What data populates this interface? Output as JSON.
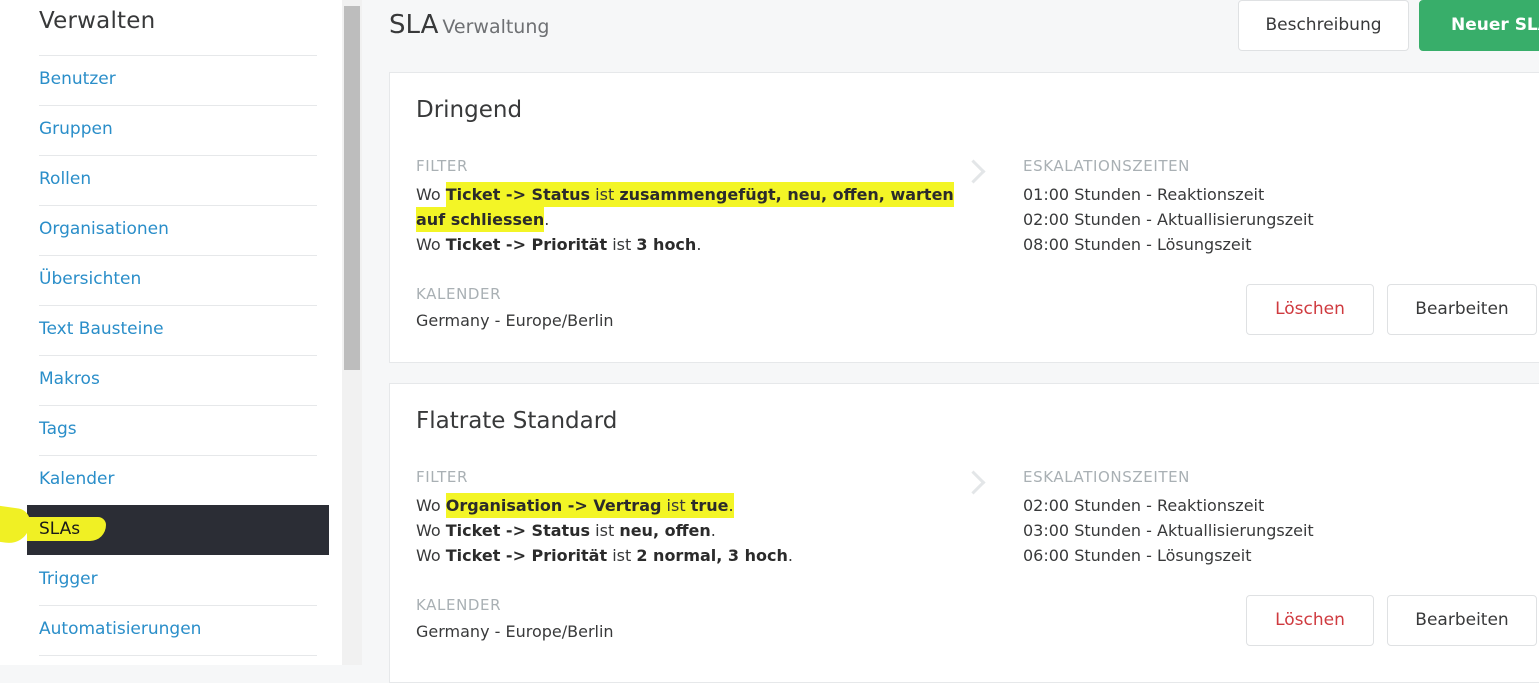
{
  "sidebar": {
    "title": "Verwalten",
    "items": [
      {
        "label": "Benutzer",
        "active": false
      },
      {
        "label": "Gruppen",
        "active": false
      },
      {
        "label": "Rollen",
        "active": false
      },
      {
        "label": "Organisationen",
        "active": false
      },
      {
        "label": "Übersichten",
        "active": false
      },
      {
        "label": "Text Bausteine",
        "active": false
      },
      {
        "label": "Makros",
        "active": false
      },
      {
        "label": "Tags",
        "active": false
      },
      {
        "label": "Kalender",
        "active": false
      },
      {
        "label": "SLAs",
        "active": true
      },
      {
        "label": "Trigger",
        "active": false
      },
      {
        "label": "Automatisierungen",
        "active": false
      }
    ]
  },
  "header": {
    "title": "SLA",
    "subtitle": "Verwaltung",
    "description_button": "Beschreibung",
    "new_button": "Neuer SLA"
  },
  "labels": {
    "filter": "Filter",
    "escalation": "Eskalationszeiten",
    "calendar": "Kalender",
    "delete": "Löschen",
    "edit": "Bearbeiten"
  },
  "slas": [
    {
      "name": "Dringend",
      "filters": [
        {
          "pre": "Wo ",
          "field": "Ticket -> Status",
          "op": " ist ",
          "value": "zusammengefügt, neu, offen, warten auf schliessen",
          "post": ".",
          "highlighted": true
        },
        {
          "pre": "Wo ",
          "field": "Ticket -> Priorität",
          "op": " ist ",
          "value": "3 hoch",
          "post": ".",
          "highlighted": false
        }
      ],
      "escalations": [
        "01:00 Stunden - Reaktionszeit",
        "02:00 Stunden - Aktuallisierungszeit",
        "08:00 Stunden - Lösungszeit"
      ],
      "calendar": "Germany - Europe/Berlin"
    },
    {
      "name": "Flatrate Standard",
      "filters": [
        {
          "pre": "Wo ",
          "field": "Organisation -> Vertrag",
          "op": " ist ",
          "value": "true",
          "post": ".",
          "highlighted": true
        },
        {
          "pre": "Wo ",
          "field": "Ticket -> Status",
          "op": " ist ",
          "value": "neu, offen",
          "post": ".",
          "highlighted": false
        },
        {
          "pre": "Wo ",
          "field": "Ticket -> Priorität",
          "op": " ist ",
          "value": "2 normal, 3 hoch",
          "post": ".",
          "highlighted": false
        }
      ],
      "escalations": [
        "02:00 Stunden - Reaktionszeit",
        "03:00 Stunden - Aktuallisierungszeit",
        "06:00 Stunden - Lösungszeit"
      ],
      "calendar": "Germany - Europe/Berlin"
    }
  ],
  "colors": {
    "link": "#2a8ec9",
    "active_bg": "#2b2d35",
    "highlight": "#f3f526",
    "primary": "#38ae6a",
    "danger": "#cf3a3f"
  }
}
